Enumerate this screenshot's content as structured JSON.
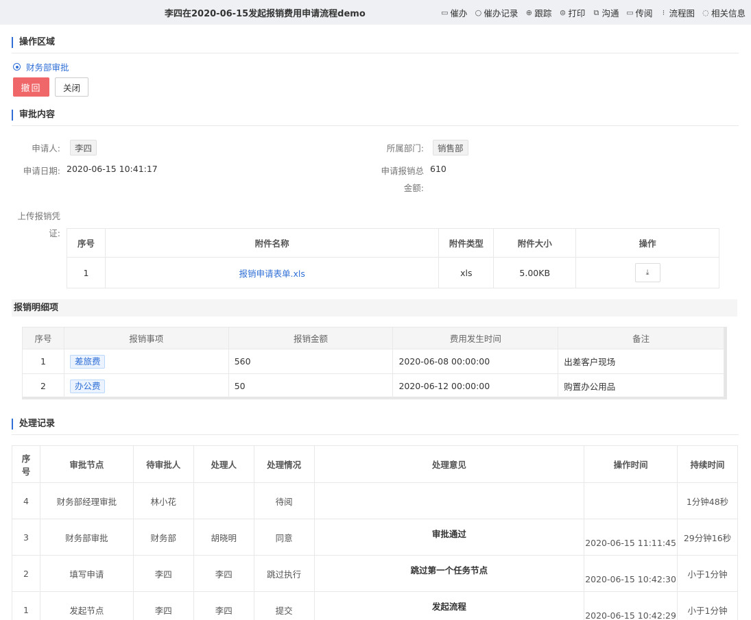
{
  "header": {
    "title": "李四在2020-06-15发起报销费用申请流程demo",
    "actions": [
      {
        "label": "催办",
        "icon": "folder-icon"
      },
      {
        "label": "催办记录",
        "icon": "search-icon"
      },
      {
        "label": "跟踪",
        "icon": "target-icon"
      },
      {
        "label": "打印",
        "icon": "print-icon"
      },
      {
        "label": "沟通",
        "icon": "chat-icon"
      },
      {
        "label": "传阅",
        "icon": "folder-icon"
      },
      {
        "label": "流程图",
        "icon": "flowchart-icon"
      },
      {
        "label": "相关信息",
        "icon": "comment-icon"
      }
    ]
  },
  "operation": {
    "title": "操作区域",
    "radio_label": "财务部审批",
    "revoke_label": "撤回",
    "close_label": "关闭"
  },
  "approval": {
    "title": "审批内容",
    "applicant_label": "申请人:",
    "applicant": "李四",
    "dept_label": "所属部门:",
    "dept": "销售部",
    "date_label": "申请日期:",
    "date": "2020-06-15 10:41:17",
    "amount_label_1": "申请报销总",
    "amount_label_2": "金额:",
    "amount": "610",
    "upload_label_1": "上传报销凭",
    "upload_label_2": "证:"
  },
  "attachments": {
    "headers": [
      "序号",
      "附件名称",
      "附件类型",
      "附件大小",
      "操作"
    ],
    "rows": [
      {
        "no": "1",
        "name": "报销申请表单.xls",
        "type": "xls",
        "size": "5.00KB"
      }
    ]
  },
  "details": {
    "title": "报销明细项",
    "headers": [
      "序号",
      "报销事项",
      "报销金额",
      "费用发生时间",
      "备注"
    ],
    "rows": [
      {
        "no": "1",
        "item": "差旅费",
        "amount": "560",
        "time": "2020-06-08 00:00:00",
        "note": "出差客户现场"
      },
      {
        "no": "2",
        "item": "办公费",
        "amount": "50",
        "time": "2020-06-12 00:00:00",
        "note": "购置办公用品"
      }
    ]
  },
  "records": {
    "title": "处理记录",
    "headers": [
      "序号",
      "审批节点",
      "待审批人",
      "处理人",
      "处理情况",
      "处理意见",
      "操作时间",
      "持续时间"
    ],
    "rows": [
      {
        "no": "4",
        "node": "财务部经理审批",
        "pending": "林小花",
        "handler": "",
        "status": "待阅",
        "opinion": "",
        "time": "",
        "duration": "1分钟48秒"
      },
      {
        "no": "3",
        "node": "财务部审批",
        "pending": "财务部",
        "handler": "胡晓明",
        "status": "同意",
        "opinion": "审批通过",
        "time": "2020-06-15 11:11:45",
        "duration": "29分钟16秒"
      },
      {
        "no": "2",
        "node": "填写申请",
        "pending": "李四",
        "handler": "李四",
        "status": "跳过执行",
        "opinion": "跳过第一个任务节点",
        "time": "2020-06-15 10:42:30",
        "duration": "小于1分钟"
      },
      {
        "no": "1",
        "node": "发起节点",
        "pending": "李四",
        "handler": "李四",
        "status": "提交",
        "opinion": "发起流程",
        "time": "2020-06-15 10:42:29",
        "duration": "小于1分钟"
      }
    ]
  }
}
